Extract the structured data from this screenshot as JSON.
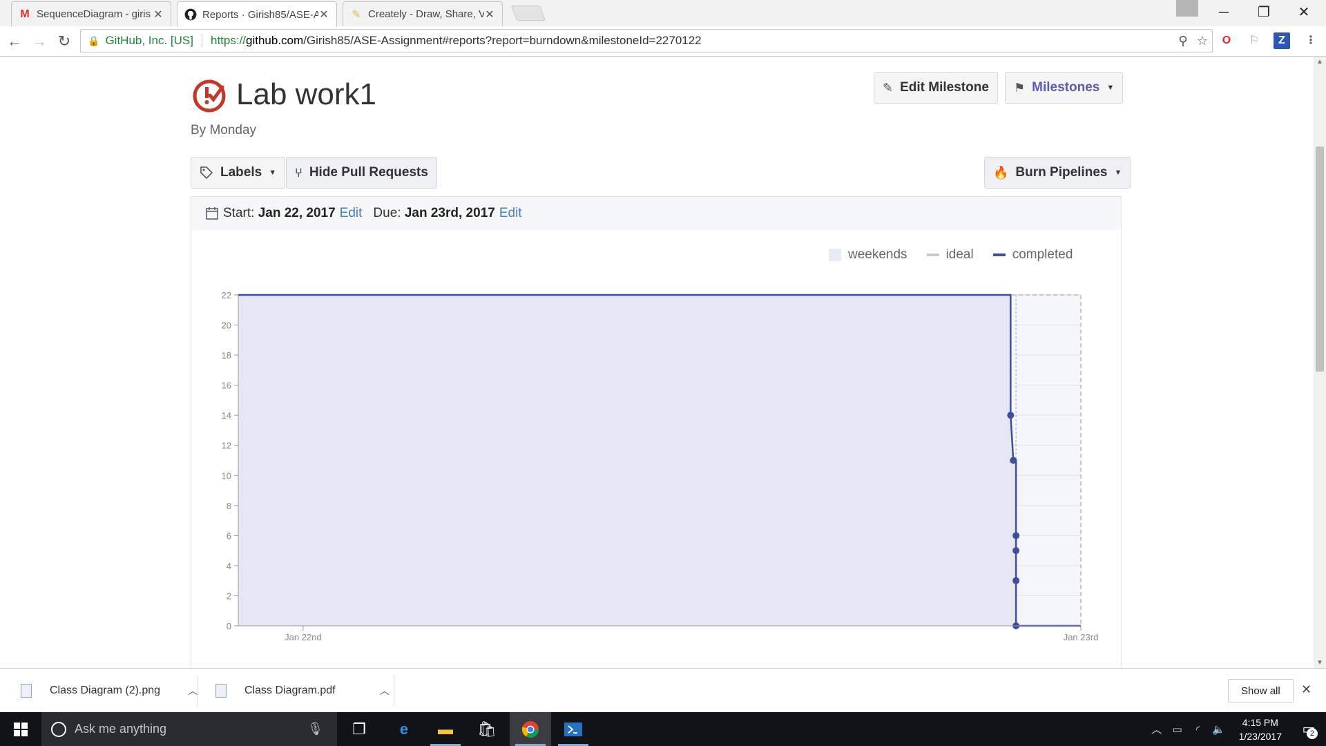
{
  "browser": {
    "tabs": [
      {
        "title": "SequenceDiagram - giris",
        "icon": "gmail-icon",
        "active": false
      },
      {
        "title": "Reports · Girish85/ASE-A",
        "icon": "github-icon",
        "active": true
      },
      {
        "title": "Creately - Draw, Share, V",
        "icon": "creately-icon",
        "active": false
      }
    ],
    "security_label": "GitHub, Inc. [US]",
    "url_scheme": "https://",
    "url_domain": "github.com",
    "url_path": "/Girish85/ASE-Assignment#reports?report=burndown&milestoneId=2270122"
  },
  "milestone": {
    "title": "Lab work1",
    "subtitle": "By Monday",
    "edit_label": "Edit Milestone",
    "milestones_label": "Milestones"
  },
  "filters": {
    "labels_label": "Labels",
    "hide_prs_label": "Hide Pull Requests",
    "burn_label": "Burn Pipelines"
  },
  "dates": {
    "start_label": "Start:",
    "start_value": "Jan 22, 2017",
    "start_edit": "Edit",
    "due_label": "Due:",
    "due_value": "Jan 23rd, 2017",
    "due_edit": "Edit"
  },
  "legend": {
    "weekends": "weekends",
    "ideal": "ideal",
    "completed": "completed"
  },
  "colors": {
    "completed": "#3f4d9c",
    "completed_fill": "#e4e6f3",
    "weekend_fill": "#f5f6fb",
    "ideal": "#c8c8c8",
    "accent_purple": "#5c5cad"
  },
  "chart_data": {
    "type": "line",
    "title": "",
    "xlabel": "",
    "ylabel": "",
    "ylim": [
      0,
      22
    ],
    "yticks": [
      0,
      2,
      4,
      6,
      8,
      10,
      12,
      14,
      16,
      18,
      20,
      22
    ],
    "xticks": [
      "Jan 22nd",
      "Jan 23rd"
    ],
    "x_range": [
      "2017-01-21 22:00",
      "2017-01-23 00:00"
    ],
    "series": [
      {
        "name": "completed",
        "style": "step",
        "points": [
          {
            "x": "2017-01-21 22:00",
            "y": 22
          },
          {
            "x": "2017-01-22 21:50",
            "y": 22
          },
          {
            "x": "2017-01-22 21:50",
            "y": 14
          },
          {
            "x": "2017-01-22 21:55",
            "y": 11
          },
          {
            "x": "2017-01-22 22:00",
            "y": 11
          },
          {
            "x": "2017-01-22 22:00",
            "y": 6
          },
          {
            "x": "2017-01-22 22:00",
            "y": 5
          },
          {
            "x": "2017-01-22 22:00",
            "y": 3
          },
          {
            "x": "2017-01-22 22:00",
            "y": 0
          },
          {
            "x": "2017-01-23 00:00",
            "y": 0
          }
        ],
        "markers": [
          {
            "x": "2017-01-22 21:50",
            "y": 14
          },
          {
            "x": "2017-01-22 21:55",
            "y": 11
          },
          {
            "x": "2017-01-22 22:00",
            "y": 6
          },
          {
            "x": "2017-01-22 22:00",
            "y": 5
          },
          {
            "x": "2017-01-22 22:00",
            "y": 3
          },
          {
            "x": "2017-01-22 22:00",
            "y": 0
          }
        ]
      },
      {
        "name": "ideal",
        "style": "dashed",
        "points": [
          {
            "x": "2017-01-21 22:00",
            "y": 22
          },
          {
            "x": "2017-01-23 00:00",
            "y": 22
          },
          {
            "x": "2017-01-23 00:00",
            "y": 0
          }
        ]
      }
    ],
    "weekend_shading": {
      "from": "2017-01-22 21:50",
      "to": "2017-01-23 00:00"
    },
    "grid": true,
    "legend_position": "top-right"
  },
  "downloads": [
    {
      "name": "Class Diagram (2).png"
    },
    {
      "name": "Class Diagram.pdf"
    }
  ],
  "downloads_show_all": "Show all",
  "taskbar": {
    "search_placeholder": "Ask me anything",
    "time": "4:15 PM",
    "date": "1/23/2017",
    "notification_count": "2"
  }
}
